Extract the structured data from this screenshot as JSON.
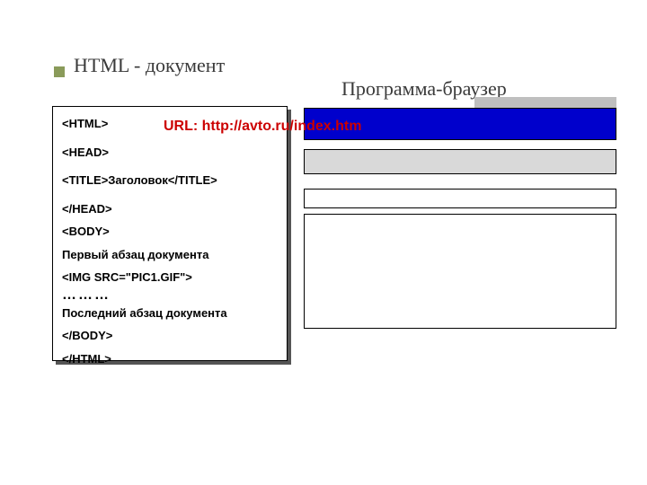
{
  "titles": {
    "left": "HTML - документ",
    "right": "Программа-браузер"
  },
  "url_label": "URL: http://avto.ru/index.htm",
  "code": {
    "l1": "<HTML>",
    "l2": "<HEAD>",
    "l3": "<TITLE>Заголовок</TITLE>",
    "l4": "</HEAD>",
    "l5": "<BODY>",
    "l6": "Первый абзац документа",
    "l7": "<IMG SRC=\"PIC1.GIF\">",
    "dots": "………",
    "l8": "Последний абзац документа",
    "l9": "</BODY>",
    "l10": "</HTML>"
  }
}
